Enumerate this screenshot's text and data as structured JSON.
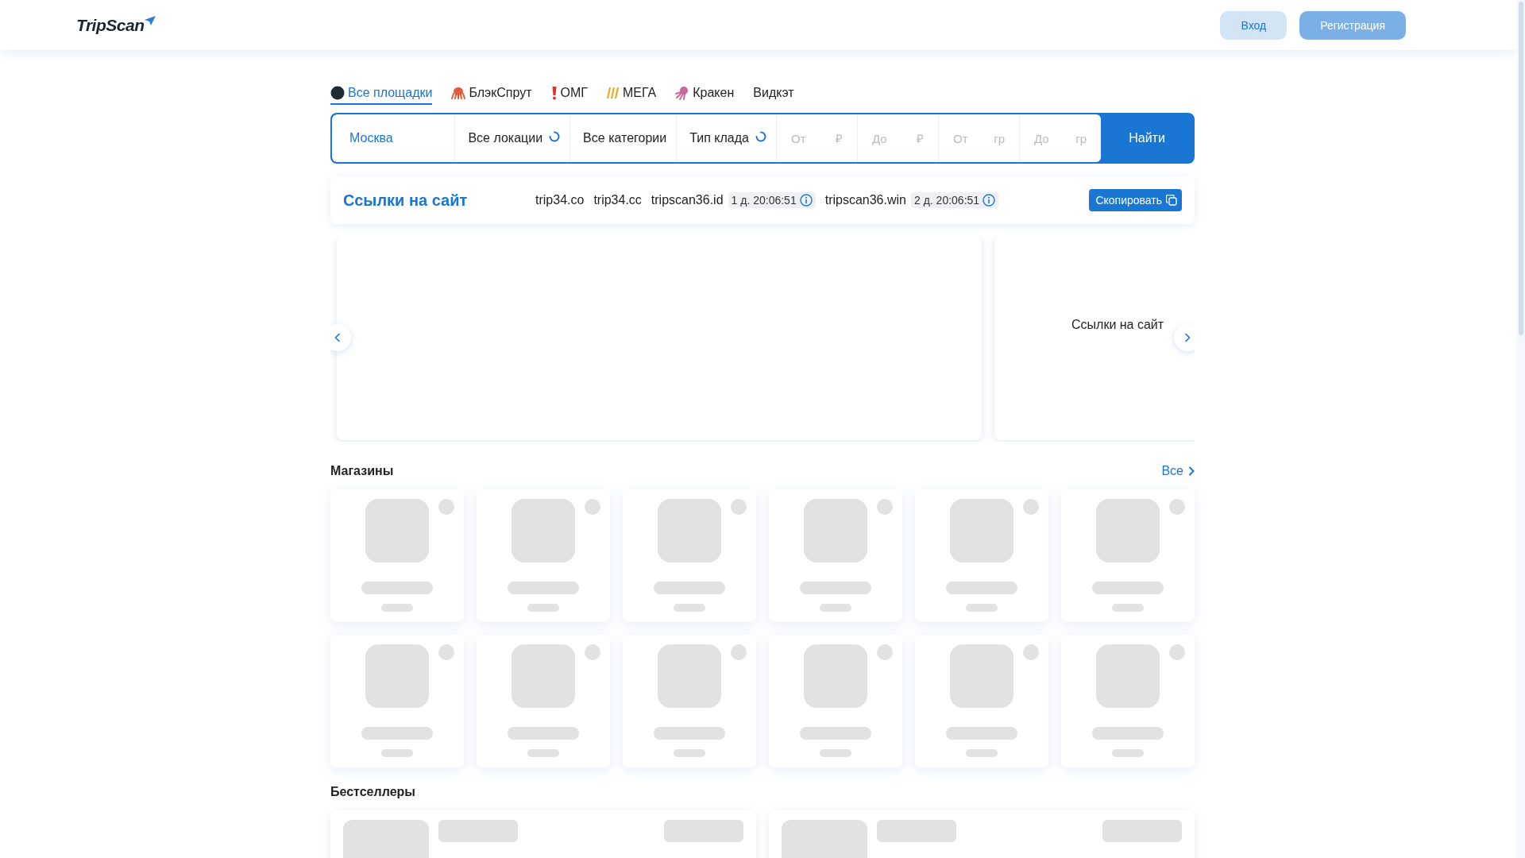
{
  "header": {
    "logo": "TripScan",
    "buttons": [
      {
        "label": "Вход",
        "kind": "secondary"
      },
      {
        "label": "Регистрация",
        "kind": "primary"
      }
    ]
  },
  "tabs": [
    {
      "label": "Все площадки",
      "selected": true
    },
    {
      "label": "БлэкСпрут",
      "selected": false
    },
    {
      "label": "ОМГ",
      "selected": false
    },
    {
      "label": "МЕГА",
      "selected": false
    },
    {
      "label": "Кракен",
      "selected": false
    },
    {
      "label": "Видкэт",
      "selected": false
    }
  ],
  "search": {
    "city": "Москва",
    "selects": [
      {
        "label": "Все локации",
        "loading": true
      },
      {
        "label": "Все категории",
        "loading": false
      },
      {
        "label": "Тип клада",
        "loading": true
      }
    ],
    "ranges": [
      {
        "placeholder": "От",
        "unit": "₽"
      },
      {
        "placeholder": "До",
        "unit": "₽"
      },
      {
        "placeholder": "От",
        "unit": "гр"
      },
      {
        "placeholder": "До",
        "unit": "гр"
      }
    ],
    "button": "Найти"
  },
  "links": {
    "title": "Ссылки на сайт",
    "domains": [
      {
        "name": "trip34.co"
      },
      {
        "name": "trip34.cc"
      },
      {
        "name": "tripscan36.id",
        "timer": "1 д. 20:06:51"
      },
      {
        "name": "tripscan36.win",
        "timer": "2 д. 20:06:51"
      }
    ],
    "copy_button": "Скопировать"
  },
  "carousel": {
    "slides": [
      {
        "kind": "blank"
      },
      {
        "kind": "caption",
        "caption": "Ссылки на сайт"
      }
    ]
  },
  "shops": {
    "title": "Магазины",
    "all_link": "Все",
    "cards": [
      {
        "kind": "skeleton"
      },
      {
        "kind": "skeleton"
      },
      {
        "kind": "skeleton"
      },
      {
        "kind": "skeleton"
      },
      {
        "kind": "skeleton"
      },
      {
        "kind": "skeleton"
      },
      {
        "kind": "skeleton"
      },
      {
        "kind": "skeleton"
      },
      {
        "kind": "skeleton"
      },
      {
        "kind": "skeleton"
      },
      {
        "kind": "skeleton"
      },
      {
        "kind": "skeleton"
      }
    ]
  },
  "bestsellers": {
    "title": "Бестселлеры",
    "cards": [
      {
        "kind": "skeleton"
      },
      {
        "kind": "skeleton"
      }
    ]
  }
}
